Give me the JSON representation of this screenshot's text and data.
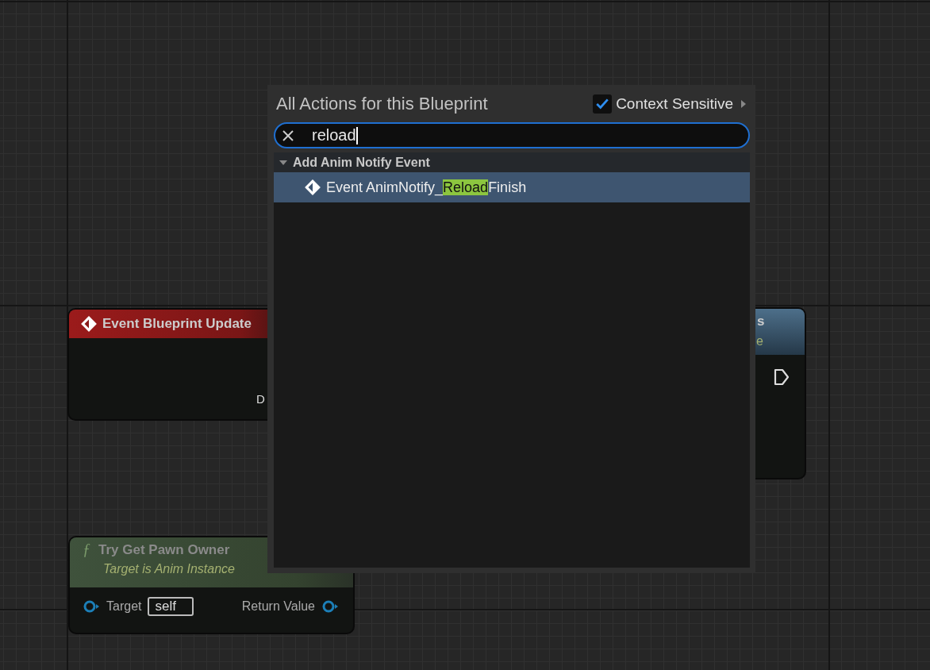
{
  "graph_nodes": [
    {
      "kind": "event",
      "title": "Event Blueprint Update",
      "pin_label": "D"
    },
    {
      "kind": "function",
      "icon": "ƒ",
      "title": "Try Get Pawn Owner",
      "subtitle": "Target is Anim Instance",
      "input_pin": "Target",
      "input_value": "self",
      "output_pin": "Return Value"
    },
    {
      "kind": "partial",
      "title": "s",
      "subtitle": "e"
    }
  ],
  "action_menu": {
    "title": "All Actions for this Blueprint",
    "context_sensitive": {
      "label": "Context Sensitive",
      "checked": true
    },
    "search": {
      "value": "reload"
    },
    "categories": [
      {
        "label": "Add Anim Notify Event",
        "expanded": true,
        "items": [
          {
            "text_before": "Event AnimNotify_",
            "match": "Reload",
            "text_after": "Finish",
            "selected": true
          }
        ]
      }
    ]
  }
}
